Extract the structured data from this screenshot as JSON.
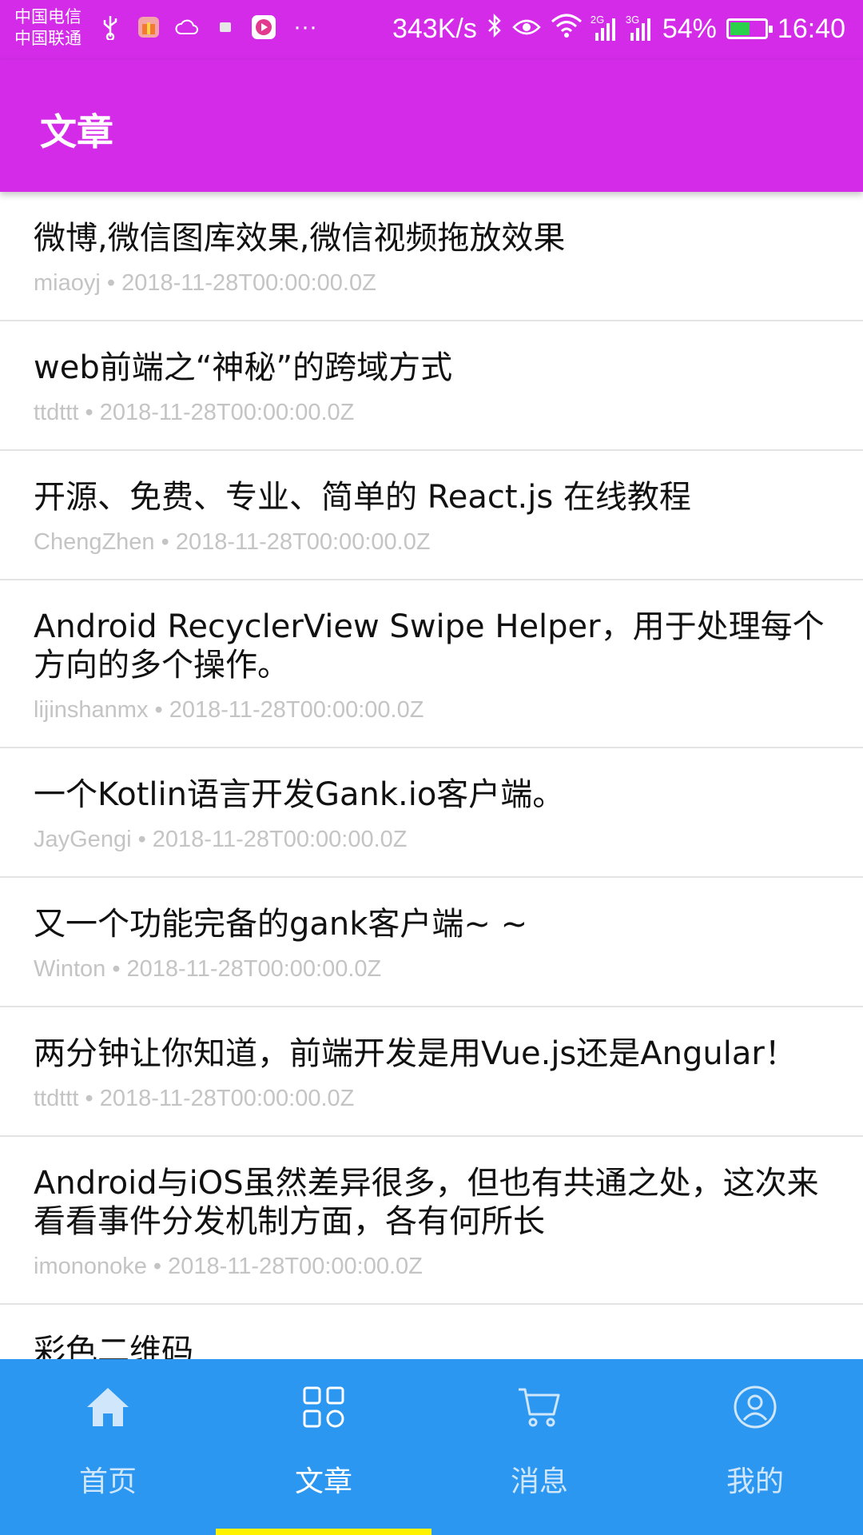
{
  "status_bar": {
    "carrier_1": "中国电信",
    "carrier_2": "中国联通",
    "more": "···",
    "speed": "343K/s",
    "net_2g": "2G",
    "net_3g": "3G",
    "battery": "54%",
    "battery_level": 0.54,
    "time": "16:40",
    "icons": [
      "usb-icon",
      "gift-icon",
      "cloud-icon",
      "square-icon",
      "video-icon",
      "bluetooth-icon",
      "eye-icon",
      "wifi-icon",
      "signal-icon",
      "battery-icon"
    ]
  },
  "app_bar": {
    "title": "文章"
  },
  "articles": [
    {
      "title": "微博,微信图库效果,微信视频拖放效果",
      "author": "miaoyj",
      "date": "2018-11-28T00:00:00.0Z"
    },
    {
      "title": "web前端之“神秘”的跨域方式",
      "author": "ttdttt",
      "date": "2018-11-28T00:00:00.0Z"
    },
    {
      "title": "开源、免费、专业、简单的 React.js 在线教程",
      "author": "ChengZhen",
      "date": "2018-11-28T00:00:00.0Z"
    },
    {
      "title": "Android RecyclerView Swipe Helper，用于处理每个方向的多个操作。",
      "author": "lijinshanmx",
      "date": "2018-11-28T00:00:00.0Z"
    },
    {
      "title": "一个Kotlin语言开发Gank.io客户端。",
      "author": "JayGengi",
      "date": "2018-11-28T00:00:00.0Z"
    },
    {
      "title": "又一个功能完备的gank客户端~ ~",
      "author": "Winton",
      "date": "2018-11-28T00:00:00.0Z"
    },
    {
      "title": "两分钟让你知道，前端开发是用Vue.js还是Angular！",
      "author": "ttdttt",
      "date": "2018-11-28T00:00:00.0Z"
    },
    {
      "title": "Android与iOS虽然差异很多，但也有共通之处，这次来看看事件分发机制方面，各有何所长",
      "author": "imononoke",
      "date": "2018-11-28T00:00:00.0Z"
    },
    {
      "title": "彩色二维码",
      "author": "",
      "date": ""
    }
  ],
  "meta_separator": " • ",
  "bottom_nav": {
    "items": [
      {
        "label": "首页",
        "icon": "home-icon"
      },
      {
        "label": "文章",
        "icon": "grid-icon"
      },
      {
        "label": "消息",
        "icon": "cart-icon"
      },
      {
        "label": "我的",
        "icon": "user-icon"
      }
    ],
    "active_index": 1
  },
  "colors": {
    "app_bar": "#d32be8",
    "bottom_nav": "#2b97f1",
    "active_indicator": "#fff200",
    "meta_text": "#c4c4c4"
  }
}
